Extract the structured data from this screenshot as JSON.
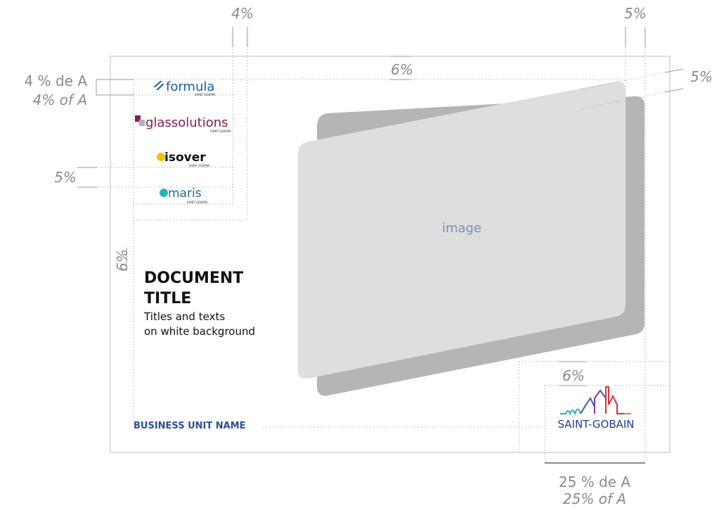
{
  "annotations": {
    "top_left_margin": "4%",
    "top_right_margin": "5%",
    "top_center": "6%",
    "left_a_fr": "4 % de A",
    "left_a_en": "4% of A",
    "right_5": "5%",
    "left_5": "5%",
    "left_6": "6%",
    "logo_6": "6%",
    "bottom_fr": "25 % de A",
    "bottom_en": "25% of A"
  },
  "logos": {
    "formula": "formula",
    "glassolutions": "glassolutions",
    "isover": "isover",
    "maris": "maris",
    "brand_small": "SAINT-GOBAIN",
    "main_brand": "SAINT-GOBAIN"
  },
  "document": {
    "title_line1": "DOCUMENT",
    "title_line2": "TITLE",
    "subtitle_line1": "Titles and texts",
    "subtitle_line2": "on white background",
    "business_unit": "BUSINESS UNIT NAME"
  },
  "image_placeholder": "image",
  "colors": {
    "formula": "#1b5cab",
    "glassolutions": "#8b1a55",
    "isover_dot": "#f2c400",
    "maris": "#1e6b8f",
    "maris_dot": "#2bb3b3",
    "business_unit": "#2a4f9a",
    "image_front": "#dedede",
    "image_shadow": "#b5b5b5"
  }
}
